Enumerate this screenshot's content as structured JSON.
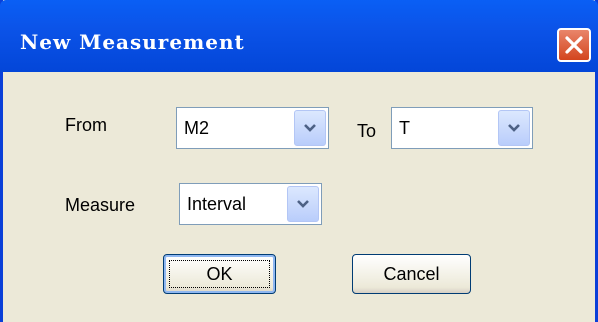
{
  "window": {
    "title": "New Measurement"
  },
  "form": {
    "from_label": "From",
    "from_value": "M2",
    "to_label": "To",
    "to_value": "T",
    "measure_label": "Measure",
    "measure_value": "Interval"
  },
  "buttons": {
    "ok": "OK",
    "cancel": "Cancel"
  },
  "icons": {
    "close": "close-icon",
    "dropdown": "chevron-down-icon"
  },
  "colors": {
    "titlebar": "#0b53e8",
    "close": "#d3451e",
    "dialog_bg": "#ece9d8"
  }
}
